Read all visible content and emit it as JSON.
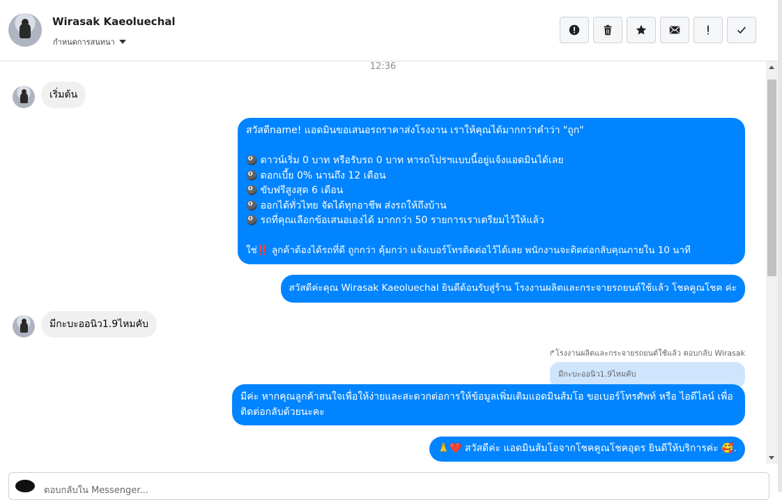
{
  "header": {
    "name": "Wirasak Kaeoluechal",
    "label_dropdown": "กำหนดการสนทนา",
    "actions": [
      "spam-icon",
      "trash-icon",
      "star-icon",
      "envelope-icon",
      "important-icon",
      "check-icon"
    ]
  },
  "timestamp": "12:36",
  "messages": {
    "m1": "เริ่มต้น",
    "m2": {
      "l1": "สวัสดีname! แอดมินขอเสนอรถราคาส่งโรงงาน เราให้คุณได้มากกว่าคำว่า \"ถูก\"",
      "l2": "ดาวน์เริ่ม 0 บาท หรือรับรถ 0 บาท หารถโปรฯแบบนี้อยู่แจ้งแอดมินได้เลย",
      "l3": "ดอกเบี้ย 0% นานถึง 12 เดือน",
      "l4": "ขับฟรีสูงสุด 6 เดือน",
      "l5": "ออกได้ทั่วไทย จัดได้ทุกอาชีพ ส่งรถให้ถึงบ้าน",
      "l6": "รถที่คุณเลือกข้อเสนอเองได้ มากกว่า 50 รายการเราเตรียมไว้ให้แล้ว",
      "l7": "ใช่‼️ ลูกค้าต้องได้รถที่ดี ถูกกว่า คุ้มกว่า แจ้งเบอร์โทรติดต่อไว้ได้เลย พนักงานจะติดต่อกลับคุณภายใน 10 นาที"
    },
    "m3": "สวัสดีค่ะคุณ Wirasak Kaeoluechal ยินดีต้อนรับสู่ร้าน โรงงานผลิตและกระจายรถยนต์ใช้แล้ว โชคคูณโชค ค่ะ",
    "m4": "มีกะบะออนิว1.9ไหมคับ",
    "reply_meta": "↱โรงงานผลิตและกระจายรถยนต์ใช้แล้ว ตอบกลับ Wirasak",
    "reply_quote": "มีกะบะออนิว1.9ไหมคับ",
    "m5": "มีค่ะ หากคุณลูกค้าสนใจเพื่อให้ง่ายและสะดวกต่อการให้ข้อมูลเพิ่มเติมแอดมินส้มโอ ขอเบอร์โทรศัพท์ หรือ ไอดีไลน์ เพื่อติดต่อกลับด้วยนะคะ",
    "m6": "🙏❤️ สวัสดีค่ะ แอดมินส้มโอจากโชคคูณโชคอุดร ยินดีให้บริการค่ะ 🥰."
  },
  "composer": {
    "placeholder": "ตอบกลับใน Messenger..."
  },
  "colors": {
    "outgoing": "#0084ff",
    "incoming": "#f0f0f0",
    "quote": "#cfe4fd"
  }
}
